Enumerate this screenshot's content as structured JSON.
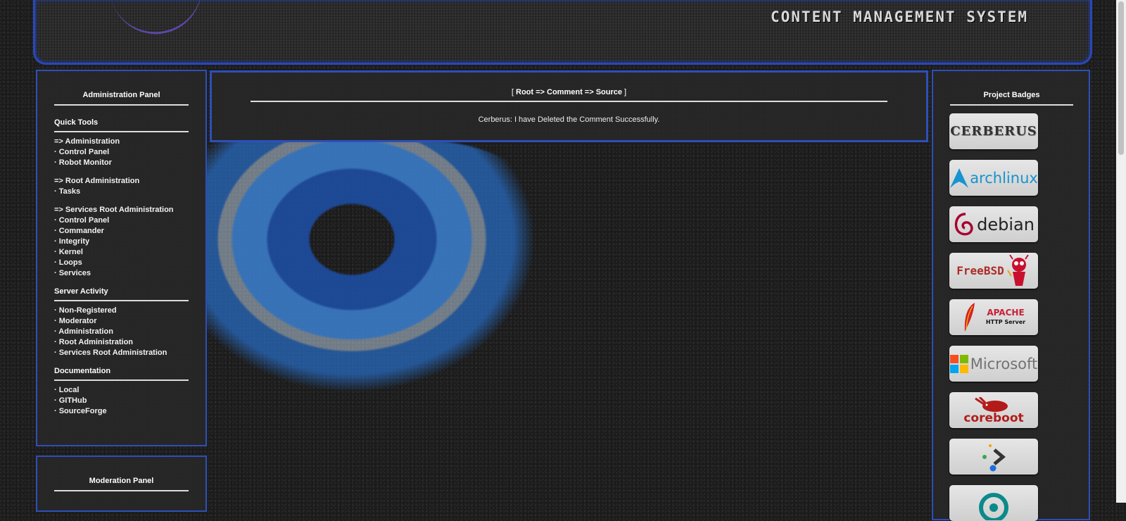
{
  "header": {
    "title": "CONTENT MANAGEMENT SYSTEM"
  },
  "admin_panel": {
    "title": "Administration Panel",
    "quick_tools": {
      "heading": "Quick Tools",
      "groups": [
        {
          "header": "=> Administration",
          "items": [
            "· Control Panel",
            "· Robot Monitor"
          ]
        },
        {
          "header": "=> Root Administration",
          "items": [
            "· Tasks"
          ]
        },
        {
          "header": "=> Services Root Administration",
          "items": [
            "· Control Panel",
            "· Commander",
            "· Integrity",
            "· Kernel",
            "· Loops",
            "· Services"
          ]
        }
      ]
    },
    "server_activity": {
      "heading": "Server Activity",
      "items": [
        "· Non-Registered",
        "· Moderator",
        "· Administration",
        "· Root Administration",
        "· Services Root Administration"
      ]
    },
    "documentation": {
      "heading": "Documentation",
      "items": [
        "· Local",
        "· GITHub",
        "· SourceForge"
      ]
    }
  },
  "moderation_panel": {
    "title": "Moderation Panel"
  },
  "main": {
    "bracket_open": "[",
    "bracket_close": "]",
    "breadcrumb": "Root => Comment => Source",
    "message": "Cerberus: I have Deleted the Comment Successfully."
  },
  "badges_panel": {
    "title": "Project Badges",
    "badges": [
      {
        "icon": "cerberus-logo",
        "label": "CERBERUS",
        "color": "#333333"
      },
      {
        "icon": "archlinux-logo",
        "label": "archlinux",
        "color": "#1793d1"
      },
      {
        "icon": "debian-logo",
        "label": "debian",
        "color": "#a80030"
      },
      {
        "icon": "freebsd-logo",
        "label": "FreeBSD",
        "color": "#ab2b28"
      },
      {
        "icon": "apache-logo",
        "label": "APACHE",
        "sublabel": "HTTP Server",
        "color": "#c92037"
      },
      {
        "icon": "microsoft-logo",
        "label": "Microsoft",
        "color": "#737373"
      },
      {
        "icon": "coreboot-logo",
        "label": "coreboot",
        "color": "#b31b1b"
      },
      {
        "icon": "dots-arrow-logo",
        "label": "",
        "color": "#333333"
      },
      {
        "icon": "ring-logo",
        "label": "",
        "color": "#0b8a8a"
      }
    ]
  }
}
